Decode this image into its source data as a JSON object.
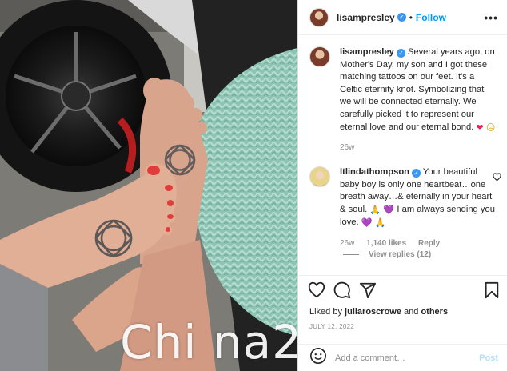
{
  "header": {
    "username": "lisampresley",
    "separator": "•",
    "follow_label": "Follow",
    "more_label": "•••"
  },
  "caption": {
    "username": "lisampresley",
    "text": "Several years ago, on Mother's Day, my son and I got these matching tattoos on our feet. It's a Celtic eternity knot. Symbolizing that we will be connected eternally. We carefully picked it to represent our eternal love and our eternal bond.",
    "emoji_heart": "❤",
    "emoji_sad": "☹",
    "time": "26w"
  },
  "comment": {
    "username": "ltlindathompson",
    "text_1": "Your beautiful baby boy is only one heartbeat…one breath away…& eternally in your heart & soul.",
    "text_2": "I am always sending you love.",
    "emoji_pray": "🙏",
    "emoji_purple_heart": "💜",
    "time": "26w",
    "likes": "1,140 likes",
    "reply_label": "Reply",
    "view_replies": "View replies (12)"
  },
  "likes": {
    "prefix": "Liked by",
    "user": "juliaroscrowe",
    "joiner": "and",
    "others": "others"
  },
  "date": "JULY 12, 2022",
  "add_comment": {
    "placeholder": "Add a comment…",
    "post_label": "Post"
  },
  "watermark": "Chi na2",
  "icons": [
    "heart-icon",
    "comment-icon",
    "share-icon",
    "bookmark-icon",
    "smiley-icon",
    "more-icon",
    "verified-icon"
  ],
  "colors": {
    "accent": "#0095f6",
    "verified": "#3897f0",
    "post_disabled": "#b2dffc",
    "muted": "#8e8e8e"
  }
}
